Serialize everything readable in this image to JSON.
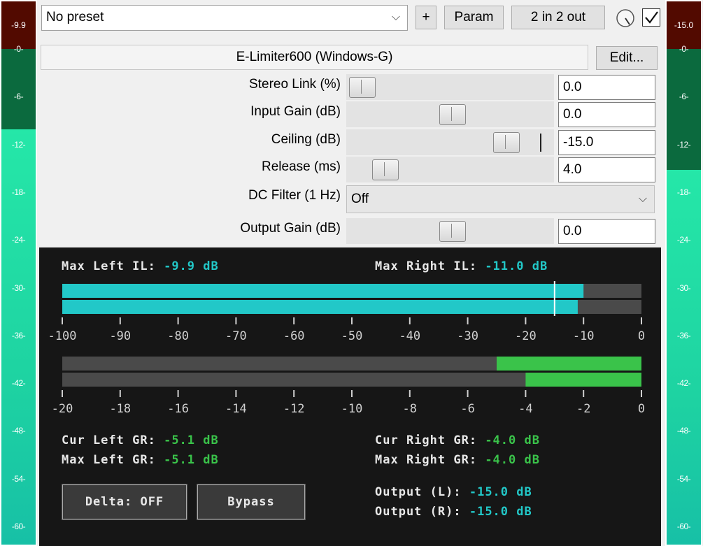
{
  "left_meter": {
    "peak": "-9.9",
    "level_db": -9.9,
    "ticks": [
      "-0-",
      "-6-",
      "-12-",
      "-18-",
      "-24-",
      "-30-",
      "-36-",
      "-42-",
      "-48-",
      "-54-",
      "-60-"
    ]
  },
  "right_meter": {
    "peak": "-15.0",
    "level_db": -15.0,
    "ticks": [
      "-0-",
      "-6-",
      "-12-",
      "-18-",
      "-24-",
      "-30-",
      "-36-",
      "-42-",
      "-48-",
      "-54-",
      "-60-"
    ]
  },
  "toolbar": {
    "preset": "No preset",
    "add_label": "+",
    "param_label": "Param",
    "io_label": "2 in 2 out",
    "enabled": true
  },
  "plugin": {
    "title": "E-Limiter600 (Windows-G)",
    "edit_label": "Edit..."
  },
  "params": [
    {
      "label": "Stereo Link (%)",
      "value": "0.0",
      "slider_fraction": 0.0
    },
    {
      "label": "Input Gain (dB)",
      "value": "0.0",
      "slider_fraction": 0.5
    },
    {
      "label": "Ceiling (dB)",
      "value": "-15.0",
      "slider_fraction": 0.8
    },
    {
      "label": "Release (ms)",
      "value": "4.0",
      "slider_fraction": 0.13
    },
    {
      "label": "DC Filter (1 Hz)",
      "value": "Off"
    },
    {
      "label": "Output Gain (dB)",
      "value": "0.0",
      "slider_fraction": 0.5
    }
  ],
  "display": {
    "max_left_il_label": "Max Left IL:",
    "max_left_il_value": "-9.9 dB",
    "max_right_il_label": "Max Right IL:",
    "max_right_il_value": "-11.0 dB",
    "input_scale": [
      "-100",
      "-90",
      "-80",
      "-70",
      "-60",
      "-50",
      "-40",
      "-30",
      "-20",
      "-10",
      "0"
    ],
    "input_left_db": -10,
    "input_right_db": -11,
    "ceiling_marker_db": -15,
    "gr_scale": [
      "-20",
      "-18",
      "-16",
      "-14",
      "-12",
      "-10",
      "-8",
      "-6",
      "-4",
      "-2",
      "0"
    ],
    "gr_left_db": -5,
    "gr_right_db": -4,
    "cur_left_gr_label": "Cur Left GR:",
    "cur_left_gr_value": "-5.1 dB",
    "max_left_gr_label": "Max Left GR:",
    "max_left_gr_value": "-5.1 dB",
    "cur_right_gr_label": "Cur Right GR:",
    "cur_right_gr_value": "-4.0 dB",
    "max_right_gr_label": "Max Right GR:",
    "max_right_gr_value": "-4.0 dB",
    "delta_label": "Delta: OFF",
    "bypass_label": "Bypass",
    "output_l_label": "Output (L):",
    "output_l_value": "-15.0 dB",
    "output_r_label": "Output (R):",
    "output_r_value": "-15.0 dB"
  },
  "colors": {
    "cyan": "#22c8c8",
    "green": "#3ac34a",
    "meter_lit": "#1ed3a2",
    "meter_dark": "#0b6a3e",
    "peak_red": "#520a00"
  }
}
